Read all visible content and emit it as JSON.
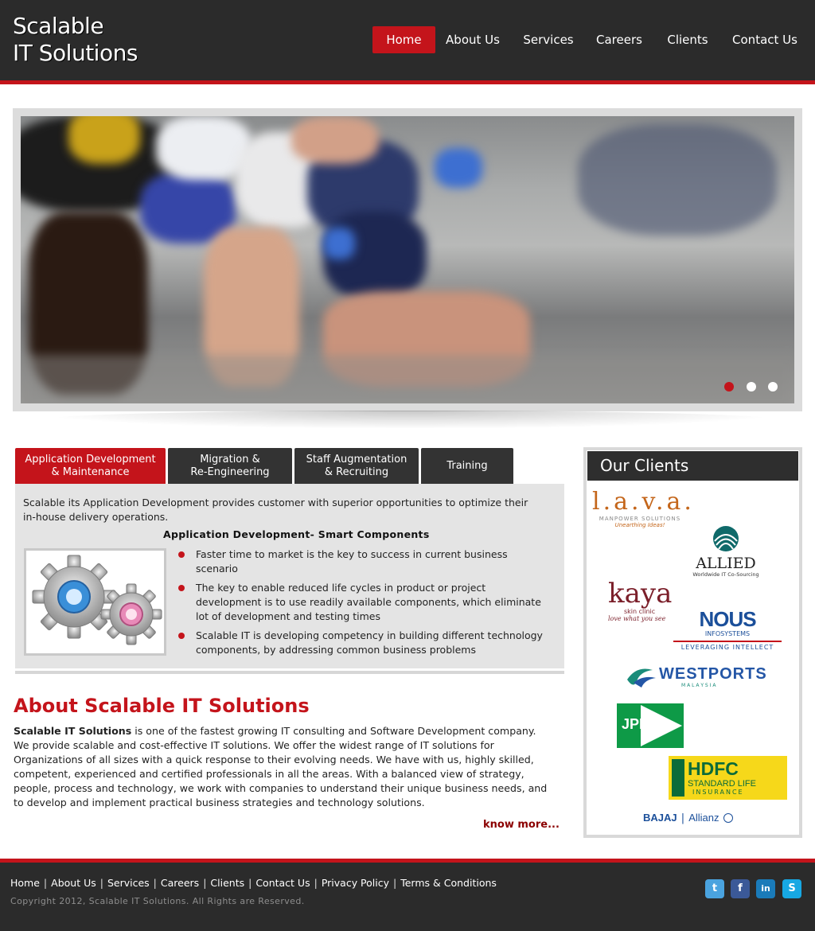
{
  "logo": {
    "line1": "Scalable",
    "line2": "IT Solutions"
  },
  "nav": {
    "items": [
      {
        "label": "Home",
        "active": true
      },
      {
        "label": "About Us",
        "active": false
      },
      {
        "label": "Services",
        "active": false
      },
      {
        "label": "Careers",
        "active": false
      },
      {
        "label": "Clients",
        "active": false
      },
      {
        "label": "Contact Us",
        "active": false
      }
    ]
  },
  "slider": {
    "slide_count": 3,
    "active_slide": 1
  },
  "tabs": {
    "items": [
      {
        "label": "Application Development\n& Maintenance",
        "active": true
      },
      {
        "label": "Migration &\nRe-Engineering",
        "active": false
      },
      {
        "label": "Staff Augmentation\n& Recruiting",
        "active": false
      },
      {
        "label": "Training",
        "active": false
      }
    ],
    "panel": {
      "intro": "Scalable its Application Development provides customer with superior opportunities to optimize their in-house delivery operations.",
      "heading": "Application Development- Smart Components",
      "image_icon": "gears-icon",
      "bullets": [
        "Faster time to market is the key to success in current business scenario",
        "The key to enable reduced life cycles in product or project development is to use readily available components, which eliminate lot of development and testing times",
        "Scalable IT is developing competency in building different technology components, by addressing common business problems"
      ]
    }
  },
  "about": {
    "title": "About Scalable IT Solutions",
    "company_name": "Scalable IT Solutions",
    "body": " is one of the fastest growing IT consulting and Software Development company. We provide scalable and cost-effective IT solutions. We offer the widest range of IT solutions for Organizations of all sizes with a quick response to their evolving needs. We have with us, highly skilled, competent, experienced and certified professionals in all the areas. With a balanced view of strategy, people, process and technology, we work with companies to understand their unique business needs, and to develop and implement practical business strategies and technology solutions.",
    "know_more": "know more..."
  },
  "clients": {
    "title": "Our Clients",
    "logos": {
      "lava": {
        "name": "l.a.v.a.",
        "sub": "MANPOWER SOLUTIONS",
        "tag": "Unearthing Ideas!"
      },
      "allied": {
        "name": "ALLIED",
        "sub": "Worldwide IT Co-Sourcing"
      },
      "kaya": {
        "name": "kaya",
        "sub": "skin clinic",
        "tag": "love what you see"
      },
      "nous": {
        "name": "NOUS",
        "sub": "INFOSYSTEMS",
        "tag": "LEVERAGING INTELLECT"
      },
      "westports": {
        "name": "WESTPORTS",
        "sub": "M A L A Y S I A"
      },
      "jpe": {
        "name": "JPE"
      },
      "hdfc": {
        "name": "HDFC",
        "sub": "STANDARD LIFE",
        "tag": "INSURANCE"
      },
      "bajaj": {
        "name": "BAJAJ",
        "sub": "Allianz"
      }
    }
  },
  "footer": {
    "links": [
      "Home",
      "About Us",
      "Services",
      "Careers",
      "Clients",
      "Contact Us",
      "Privacy Policy",
      "Terms & Conditions"
    ],
    "copyright": "Copyright 2012, Scalable IT Solutions. All Rights are Reserved.",
    "social": [
      {
        "icon": "twitter-icon",
        "glyph": "t",
        "color": "#4aa3df"
      },
      {
        "icon": "facebook-icon",
        "glyph": "f",
        "color": "#3b5998"
      },
      {
        "icon": "linkedin-icon",
        "glyph": "in",
        "color": "#1a7bb9"
      },
      {
        "icon": "skype-icon",
        "glyph": "S",
        "color": "#17a8e3"
      }
    ]
  },
  "colors": {
    "brand_red": "#c4141b",
    "header_bg": "#2b2b2b",
    "panel_bg": "#e4e4e4"
  }
}
